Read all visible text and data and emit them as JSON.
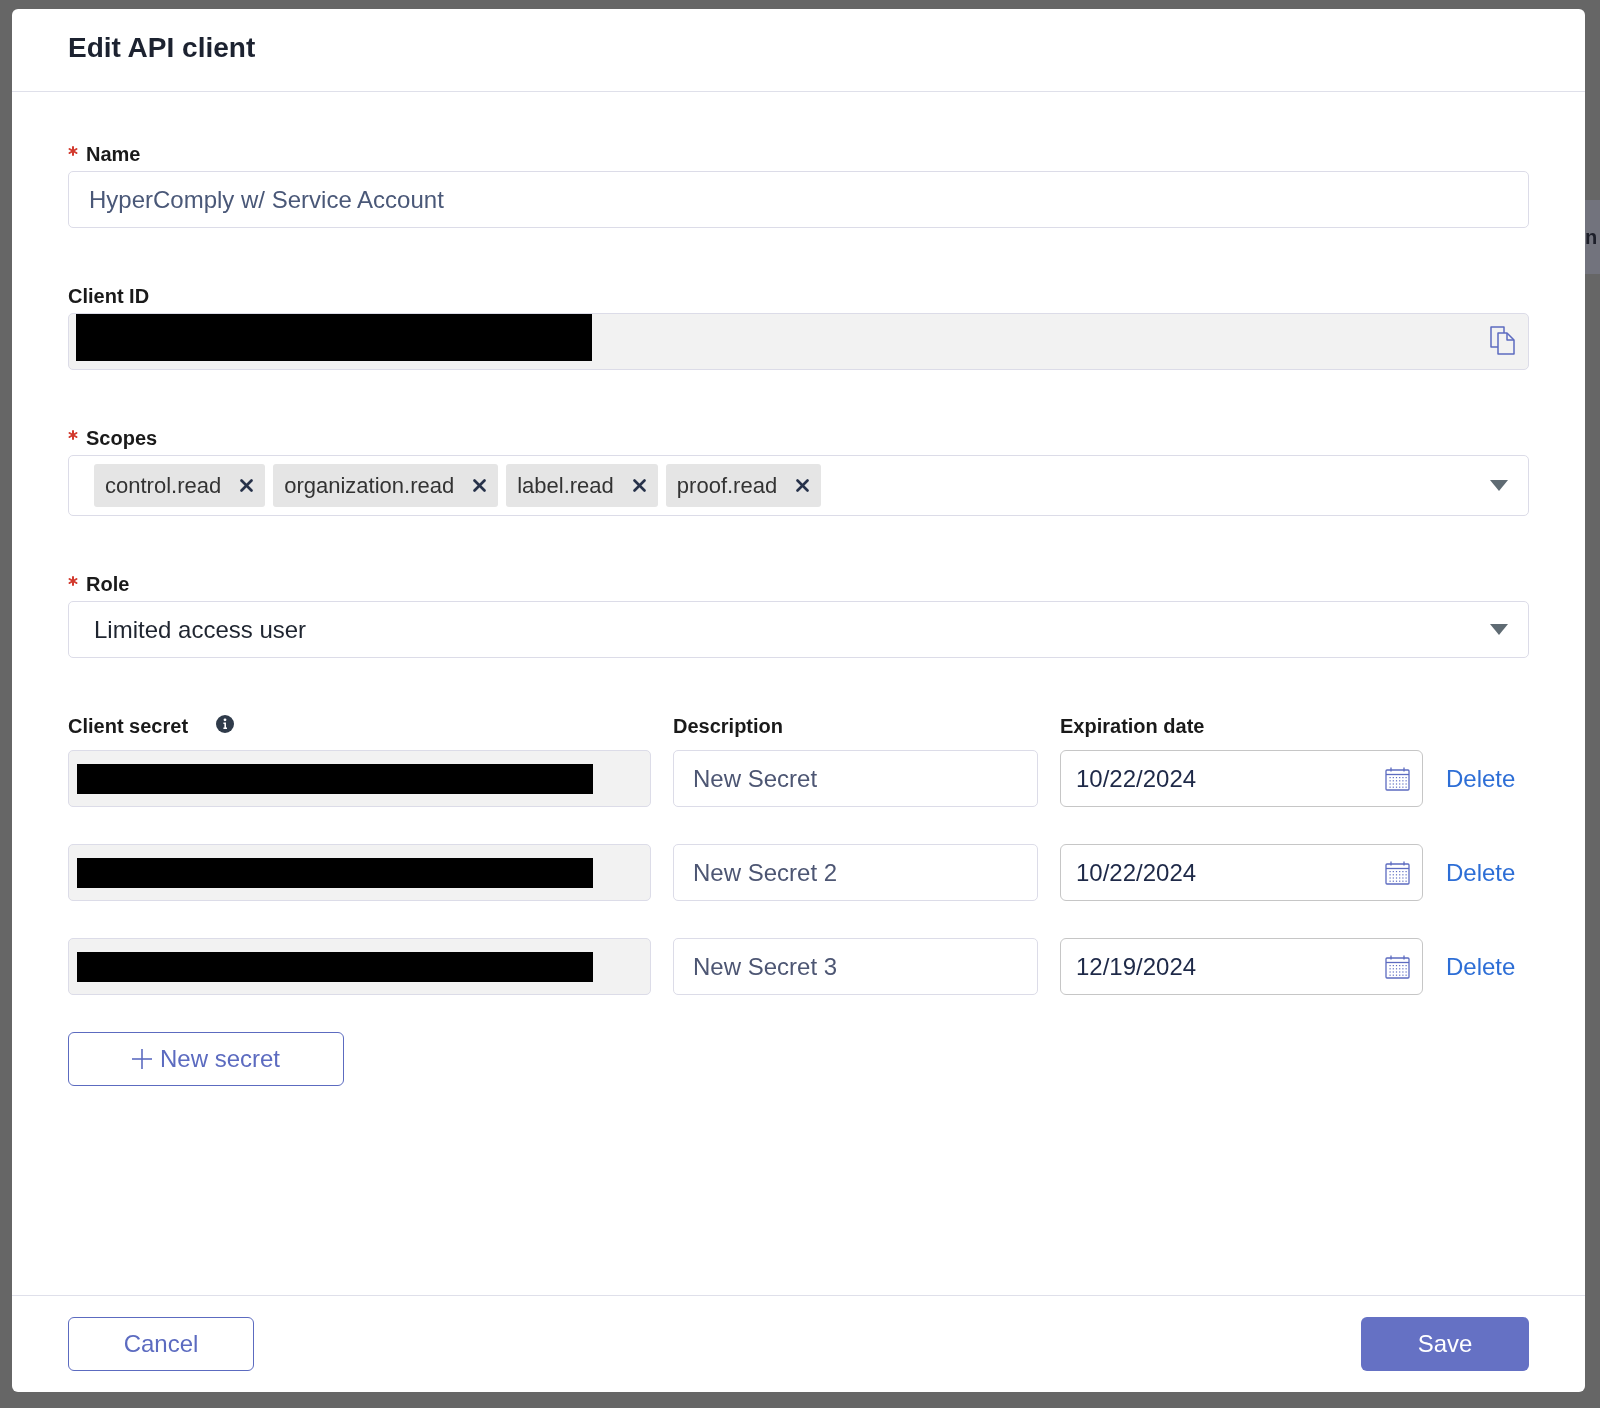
{
  "dialog": {
    "title": "Edit API client"
  },
  "fields": [
    {
      "kind": "text",
      "label": "Name",
      "required": true,
      "value": "HyperComply w/ Service Account"
    },
    {
      "kind": "copy",
      "label": "Client ID",
      "required": false
    },
    {
      "kind": "tags",
      "label": "Scopes",
      "required": true,
      "tags": [
        "control.read",
        "organization.read",
        "label.read",
        "proof.read"
      ]
    },
    {
      "kind": "select",
      "label": "Role",
      "required": true,
      "value": "Limited access user"
    }
  ],
  "secrets": {
    "columns": [
      {
        "label": "Client secret",
        "info": true
      },
      {
        "label": "Description",
        "info": false
      },
      {
        "label": "Expiration date",
        "info": false
      }
    ],
    "rows": [
      {
        "description": "New Secret",
        "expiration_date": "10/22/2024",
        "action": "Delete"
      },
      {
        "description": "New Secret 2",
        "expiration_date": "10/22/2024",
        "action": "Delete"
      },
      {
        "description": "New Secret 3",
        "expiration_date": "12/19/2024",
        "action": "Delete"
      }
    ],
    "add_button": "New secret"
  },
  "footer": {
    "buttons": [
      {
        "label": "Cancel",
        "kind": "secondary"
      },
      {
        "label": "Save",
        "kind": "primary"
      }
    ]
  },
  "background": {
    "text": "n"
  }
}
